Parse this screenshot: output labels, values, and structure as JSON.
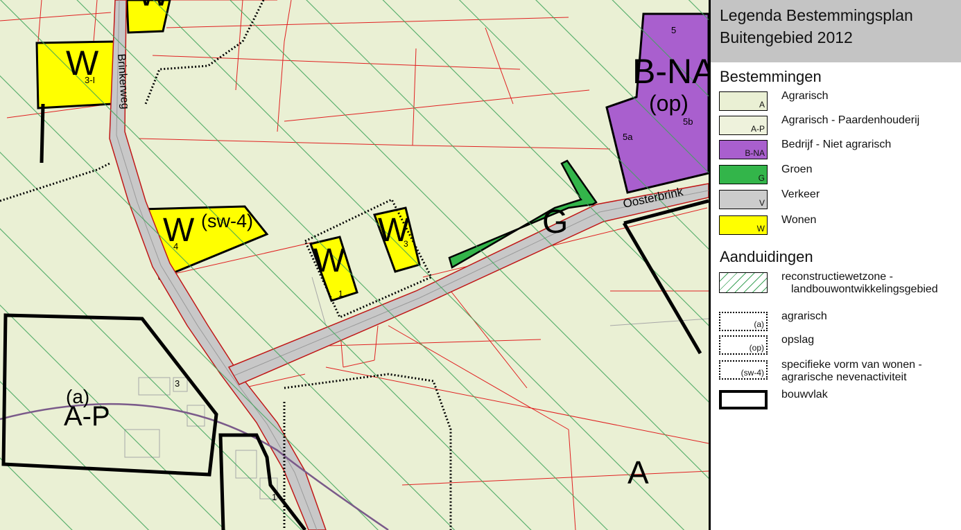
{
  "legend": {
    "title_line1": "Legenda Bestemmingsplan",
    "title_line2": "Buitengebied 2012",
    "section_bestemmingen": "Bestemmingen",
    "section_aanduidingen": "Aanduidingen",
    "bestemmingen": [
      {
        "code": "A",
        "label": "Agrarisch",
        "color": "#eaf0d4"
      },
      {
        "code": "A-P",
        "label": "Agrarisch - Paardenhouderij",
        "color": "#eef2dc"
      },
      {
        "code": "B-NA",
        "label": "Bedrijf - Niet agrarisch",
        "color": "#a95fce"
      },
      {
        "code": "G",
        "label": "Groen",
        "color": "#33b54a"
      },
      {
        "code": "V",
        "label": "Verkeer",
        "color": "#cccccc"
      },
      {
        "code": "W",
        "label": "Wonen",
        "color": "#ffff00"
      }
    ],
    "aanduidingen": [
      {
        "code": "",
        "label1": "reconstructiewetzone -",
        "label2": "landbouwontwikkelingsgebied",
        "kind": "hatch"
      },
      {
        "code": "(a)",
        "label1": "agrarisch",
        "label2": "",
        "kind": "dotted"
      },
      {
        "code": "(op)",
        "label1": "opslag",
        "label2": "",
        "kind": "dotted"
      },
      {
        "code": "(sw-4)",
        "label1": "specifieke vorm van wonen -",
        "label2": "agrarische nevenactiviteit",
        "kind": "dotted"
      },
      {
        "code": "",
        "label1": "bouwvlak",
        "label2": "",
        "kind": "thick"
      }
    ]
  },
  "map": {
    "street_brinkerweg": "Brinkerweg",
    "street_oosterbrink": "Oosterbrink",
    "labels": {
      "w_topleft": "W",
      "w_topleft_num": "3-I",
      "w_top": "W",
      "w_sw4": "W",
      "sw4": "(sw-4)",
      "w_sw4_num": "4",
      "w_mid1": "W",
      "w_mid1_num": "1",
      "w_mid2": "W",
      "w_mid2_num": "3",
      "g": "G",
      "bna": "B-NA",
      "op": "(op)",
      "bna_5": "5",
      "bna_5a": "5a",
      "bna_5b": "5b",
      "a_small": "(a)",
      "ap": "A-P",
      "ap_num": "3",
      "a_big": "A",
      "bottom_num": "1"
    },
    "colors": {
      "agrarisch": "#eaf0d4",
      "hatch": "#3fa35a",
      "wonen": "#ffff00",
      "groen": "#33b54a",
      "bedrijf": "#a95fce",
      "verkeer": "#c8c8c8",
      "parcel_line": "#e02020",
      "gas_line": "#7a5a8a"
    }
  }
}
